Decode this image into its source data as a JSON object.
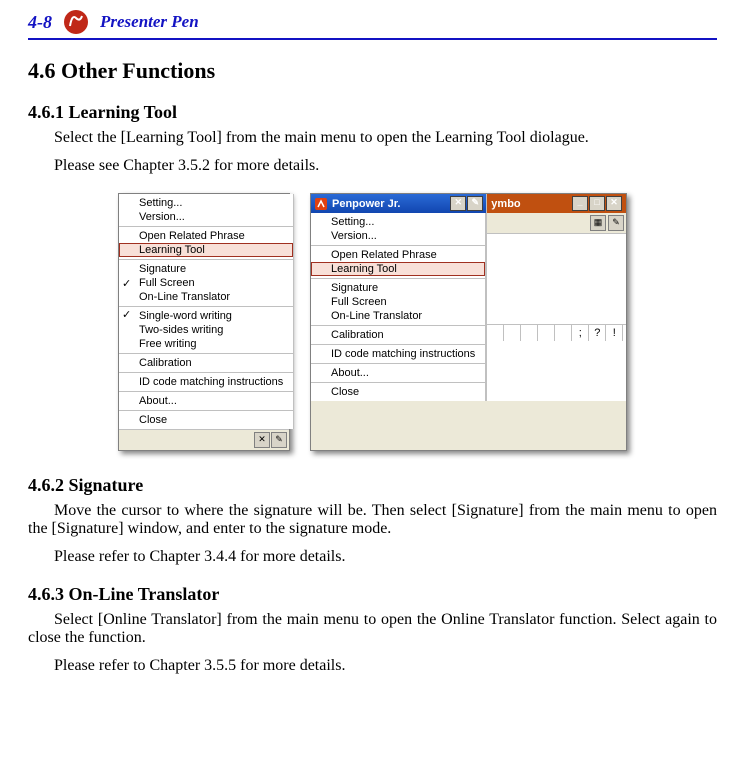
{
  "header": {
    "page_number": "4-8",
    "title": "Presenter Pen"
  },
  "sections": {
    "h2": "4.6 Other Functions",
    "s1": {
      "h3": "4.6.1 Learning Tool",
      "p1": "Select the [Learning Tool] from the main menu to open the Learning Tool diolague.",
      "p2": "Please see Chapter 3.5.2 for more details."
    },
    "s2": {
      "h3": "4.6.2 Signature",
      "p1": "Move the cursor to where the signature will be. Then select [Signature] from the main menu to open the [Signature] window, and enter to the signature mode.",
      "p2": "Please refer to Chapter 3.4.4 for more details."
    },
    "s3": {
      "h3": "4.6.3 On-Line Translator",
      "p1": "Select [Online Translator] from the main menu to open the Online Translator function. Select again to close the function.",
      "p2": "Please refer to Chapter 3.5.5 for more details."
    }
  },
  "figure1": {
    "items": [
      "Setting...",
      "Version...",
      "Open Related Phrase",
      "Learning Tool",
      "Signature",
      "Full Screen",
      "On-Line Translator",
      "Single-word writing",
      "Two-sides writing",
      "Free writing",
      "Calibration",
      "ID code matching instructions",
      "About...",
      "Close"
    ],
    "highlight_index": 3,
    "checked": [
      5,
      7
    ],
    "groups_after": [
      1,
      3,
      6,
      9,
      10,
      11,
      12
    ]
  },
  "figure2": {
    "title": "Penpower Jr.",
    "items": [
      "Setting...",
      "Version...",
      "Open Related Phrase",
      "Learning Tool",
      "Signature",
      "Full Screen",
      "On-Line Translator",
      "Calibration",
      "ID code matching instructions",
      "About...",
      "Close"
    ],
    "highlight_index": 3,
    "groups_after": [
      1,
      3,
      6,
      7,
      8,
      9
    ],
    "symbo_label": "ymbo",
    "grid_chars": [
      ";",
      "?",
      "!"
    ]
  }
}
